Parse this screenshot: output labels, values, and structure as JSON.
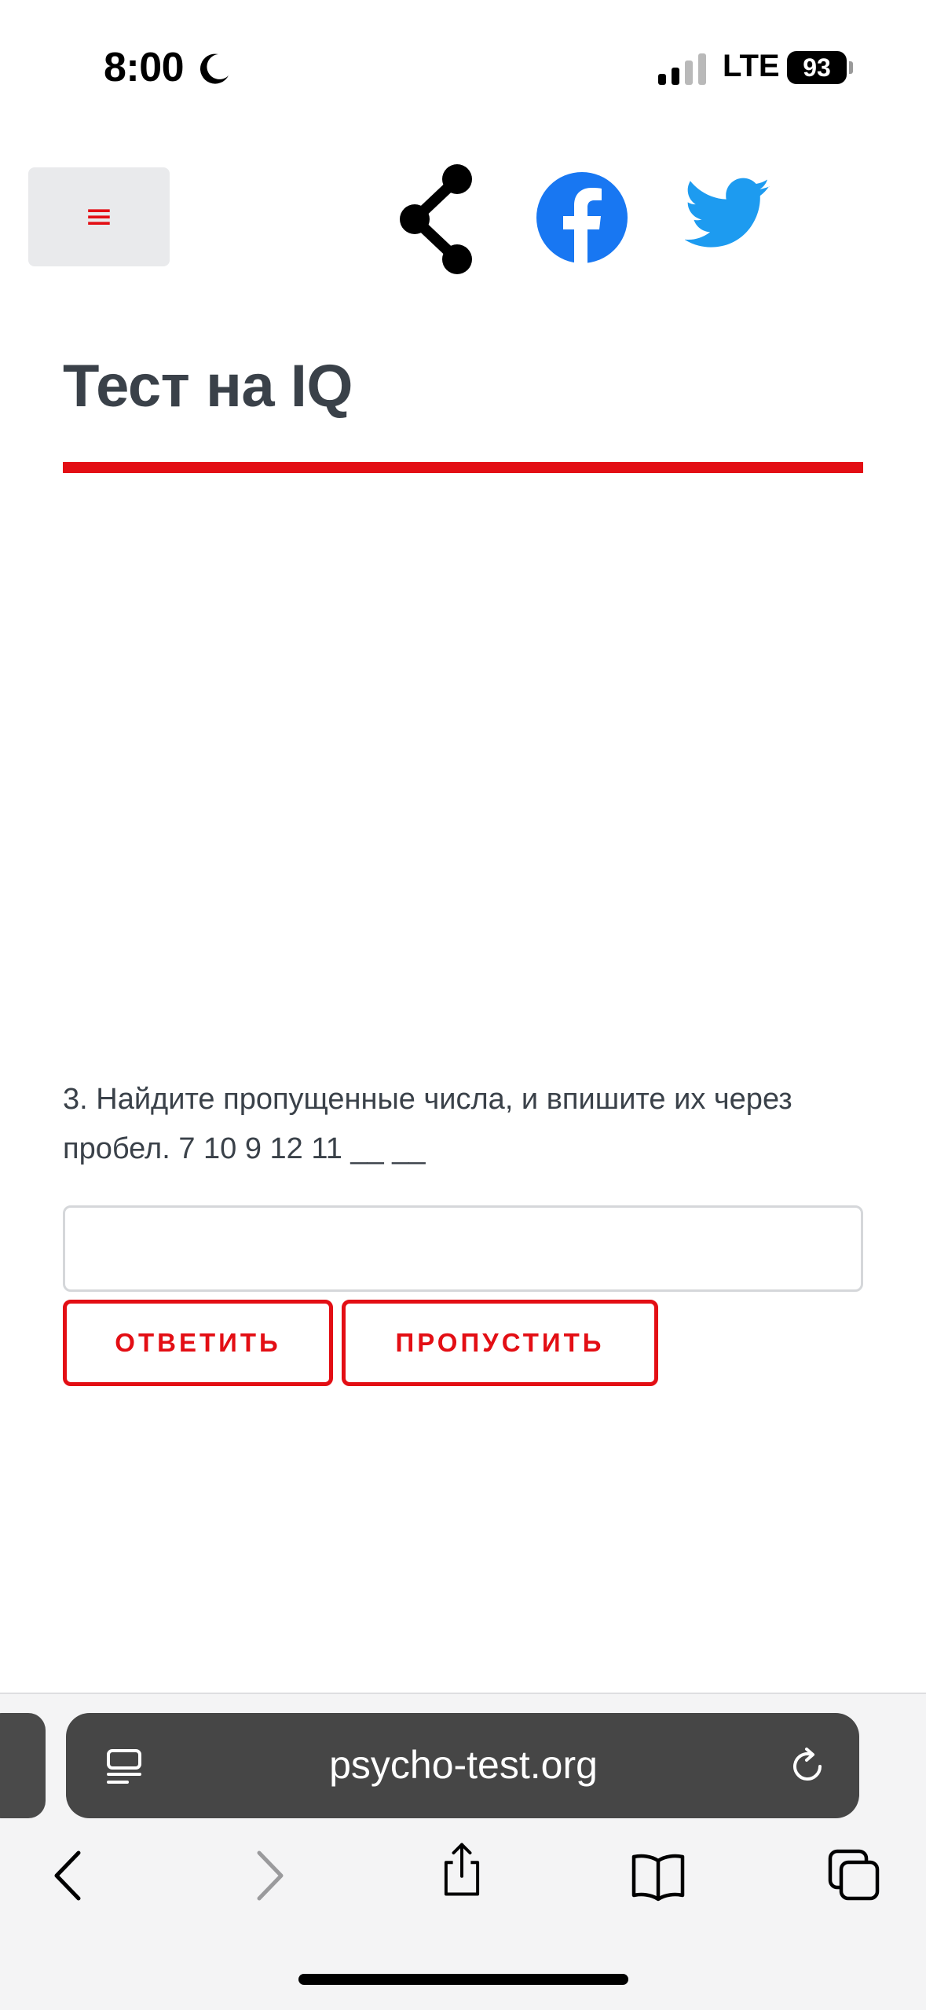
{
  "status_bar": {
    "time": "8:00",
    "network": "LTE",
    "battery": "93"
  },
  "header": {
    "menu_icon": "≡",
    "icons": [
      "share-icon",
      "facebook-icon",
      "twitter-icon"
    ],
    "accent_color": "#e30e14"
  },
  "page": {
    "title": "Тест на IQ",
    "question": "3. Найдите пропущенные числа, и впишите их через пробел. 7 10 9 12 11 __ __",
    "answer_value": "",
    "answer_button": "ОТВЕТИТЬ",
    "skip_button": "ПРОПУСТИТЬ"
  },
  "browser": {
    "address": "psycho-test.org"
  },
  "colors": {
    "accent": "#e30e14",
    "text": "#3a4149",
    "facebook": "#1877f2",
    "twitter": "#1d9bf0"
  }
}
